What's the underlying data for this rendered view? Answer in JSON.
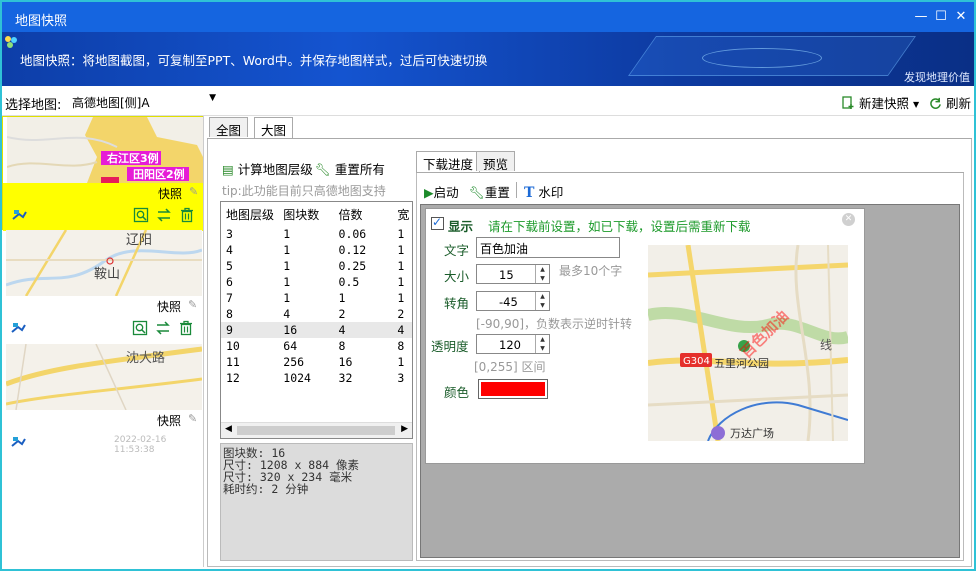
{
  "window": {
    "title": "地图快照",
    "minimize": "—",
    "maximize": "☐",
    "close": "✕"
  },
  "banner": {
    "message": "地图快照：将地图截图，可复制至PPT、Word中。并保存地图样式，过后可快速切换",
    "corner_text": "发现地理价值"
  },
  "toolbar": {
    "select_label": "选择地图:",
    "map_value": "高德地图[侧]A",
    "new_button": "新建快照",
    "refresh_button": "刷新"
  },
  "snapshots": [
    {
      "label": "快照",
      "selected": true,
      "map_labels": [
        "右江区3例",
        "田阳区2例"
      ],
      "timestamp": ""
    },
    {
      "label": "快照",
      "selected": false,
      "map_labels": [
        "辽阳",
        "鞍山"
      ],
      "timestamp": ""
    },
    {
      "label": "快照",
      "selected": false,
      "map_labels": [
        "沈大路"
      ],
      "timestamp": "2022-02-16 11:53:38"
    }
  ],
  "center": {
    "tabs": [
      "全图",
      "大图"
    ],
    "calc_button": "计算地图层级",
    "reset_all_button": "重置所有",
    "tip": "tip:此功能目前只高德地图支持",
    "grid": {
      "columns": [
        "地图层级",
        "图块数",
        "倍数",
        "宽"
      ],
      "rows": [
        [
          "3",
          "1",
          "0.06",
          "1"
        ],
        [
          "4",
          "1",
          "0.12",
          "1"
        ],
        [
          "5",
          "1",
          "0.25",
          "1"
        ],
        [
          "6",
          "1",
          "0.5",
          "1"
        ],
        [
          "7",
          "1",
          "1",
          "1"
        ],
        [
          "8",
          "4",
          "2",
          "2"
        ],
        [
          "9",
          "16",
          "4",
          "4"
        ],
        [
          "10",
          "64",
          "8",
          "8"
        ],
        [
          "11",
          "256",
          "16",
          "1"
        ],
        [
          "12",
          "1024",
          "32",
          "3"
        ]
      ],
      "highlight_row": 6
    },
    "info": [
      "图块数: 16",
      "尺寸: 1208 x 884 像素",
      "尺寸: 320 x 234 毫米",
      "耗时约: 2 分钟"
    ]
  },
  "download": {
    "tabs": [
      "下载进度",
      "预览"
    ],
    "start_button": "启动",
    "reset_button": "重置",
    "watermark_button": "水印"
  },
  "watermark": {
    "show_label": "显示",
    "show_checked": true,
    "notice": "请在下载前设置，如已下载，设置后需重新下载",
    "text_label": "文字",
    "text_value": "百色加油",
    "size_label": "大小",
    "size_value": "15",
    "size_hint": "最多10个字",
    "rotate_label": "转角",
    "rotate_value": "-45",
    "rotate_hint": "[-90,90]，负数表示逆时针转",
    "opacity_label": "透明度",
    "opacity_value": "120",
    "opacity_hint": "[0,255] 区间",
    "color_label": "颜色",
    "color_value": "#ff0000",
    "preview": {
      "stamp_text": "百色加油",
      "road_badge": "G304",
      "park": "五里河公园",
      "mall": "万达广场",
      "river_mark": "线"
    }
  }
}
